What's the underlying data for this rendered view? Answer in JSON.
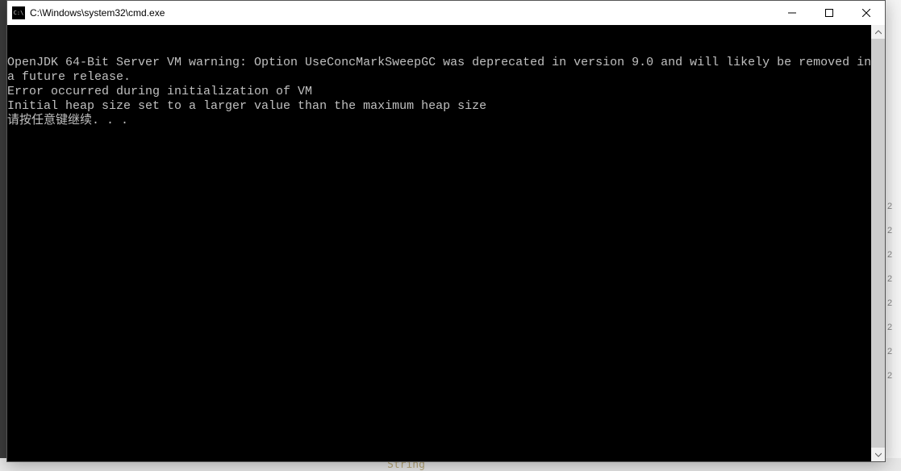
{
  "window": {
    "title": "C:\\Windows\\system32\\cmd.exe"
  },
  "terminal": {
    "lines": [
      "OpenJDK 64-Bit Server VM warning: Option UseConcMarkSweepGC was deprecated in version 9.0 and will likely be removed in a future release.",
      "Error occurred during initialization of VM",
      "Initial heap size set to a larger value than the maximum heap size",
      "请按任意键继续. . ."
    ]
  },
  "bgBottom": {
    "text": "String"
  },
  "bgRight": {
    "vals": [
      "2",
      "2",
      "2",
      "2",
      "2",
      "2",
      "2",
      "2"
    ]
  }
}
